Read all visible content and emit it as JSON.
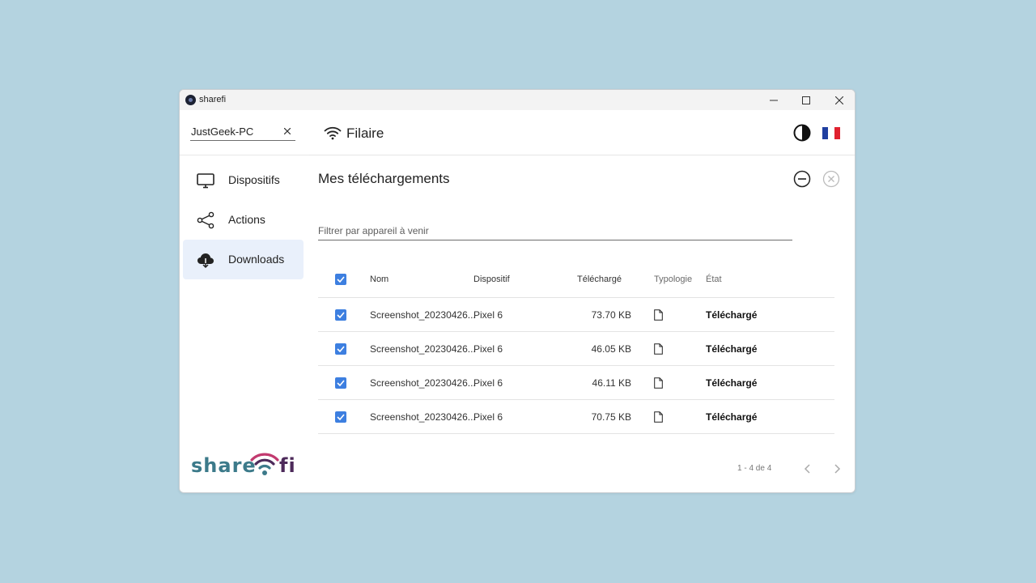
{
  "window": {
    "title": "sharefi"
  },
  "sidebar": {
    "device_name": "JustGeek-PC",
    "items": [
      {
        "label": "Dispositifs",
        "icon": "monitor-icon",
        "active": false
      },
      {
        "label": "Actions",
        "icon": "share-icon",
        "active": false
      },
      {
        "label": "Downloads",
        "icon": "cloud-download-icon",
        "active": true
      }
    ],
    "logo": {
      "left": "share",
      "right": "fi",
      "colors": {
        "teal": "#3c7a8a",
        "purple": "#4d2a5a",
        "pink": "#c23a6f"
      }
    }
  },
  "header": {
    "connection": "Filaire",
    "icons": [
      "wifi-icon",
      "theme-contrast-icon",
      "french-flag-icon"
    ]
  },
  "main": {
    "title": "Mes téléchargements",
    "filter_placeholder": "Filtrer par appareil à venir",
    "columns": {
      "name": "Nom",
      "device": "Dispositif",
      "size": "Téléchargé",
      "type": "Typologie",
      "state": "État"
    },
    "rows": [
      {
        "name": "Screenshot_20230426...",
        "device": "Pixel 6",
        "size": "73.70 KB",
        "type": "file-icon",
        "state": "Téléchargé",
        "checked": true
      },
      {
        "name": "Screenshot_20230426...",
        "device": "Pixel 6",
        "size": "46.05 KB",
        "type": "file-icon",
        "state": "Téléchargé",
        "checked": true
      },
      {
        "name": "Screenshot_20230426...",
        "device": "Pixel 6",
        "size": "46.11 KB",
        "type": "file-icon",
        "state": "Téléchargé",
        "checked": true
      },
      {
        "name": "Screenshot_20230426...",
        "device": "Pixel 6",
        "size": "70.75 KB",
        "type": "file-icon",
        "state": "Téléchargé",
        "checked": true
      }
    ],
    "pagination": "1 - 4 de 4"
  },
  "colors": {
    "accent": "#3d7fe0",
    "active_nav": "#e9f0fb",
    "background": "#b4d3e0",
    "flag_blue": "#1f3fa0",
    "flag_white": "#ffffff",
    "flag_red": "#e0212f"
  }
}
